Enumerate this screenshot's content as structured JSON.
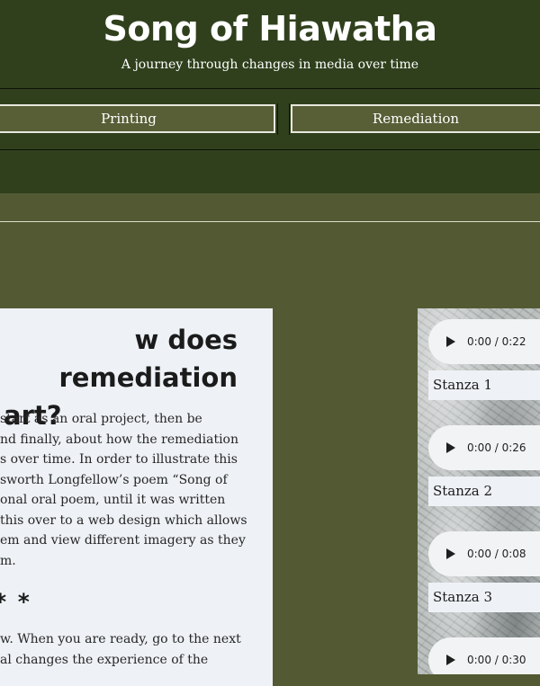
{
  "header": {
    "title": "Song of Hiawatha",
    "subtitle": "A journey through changes in media over time"
  },
  "nav": {
    "items": [
      {
        "label": "Printing"
      },
      {
        "label": "Remediation"
      }
    ]
  },
  "intro": {
    "heading_line1": "w does remediation",
    "heading_line2": "art?",
    "paragraph1": [
      "start as an oral project, then be",
      "nd finally, about how the remediation",
      "s over time. In order to illustrate this",
      "sworth Longfellow’s poem “Song of",
      "onal oral poem, until it was written",
      "this over to a web design which allows",
      "em and view different imagery as they",
      "m."
    ],
    "separator": "* *",
    "paragraph2": [
      "w. When you are ready, go to the next",
      "al changes the experience of the"
    ]
  },
  "audio": {
    "players": [
      {
        "time": "0:00 / 0:22",
        "stanza": "Stanza 1"
      },
      {
        "time": "0:00 / 0:26",
        "stanza": "Stanza 2"
      },
      {
        "time": "0:00 / 0:08",
        "stanza": "Stanza 3"
      },
      {
        "time": "0:00 / 0:30",
        "stanza": ""
      }
    ]
  },
  "colors": {
    "header_bg": "#30401d",
    "page_bg": "#535a33",
    "card_bg": "#eef1f5",
    "player_bg": "#f1f3f4"
  }
}
